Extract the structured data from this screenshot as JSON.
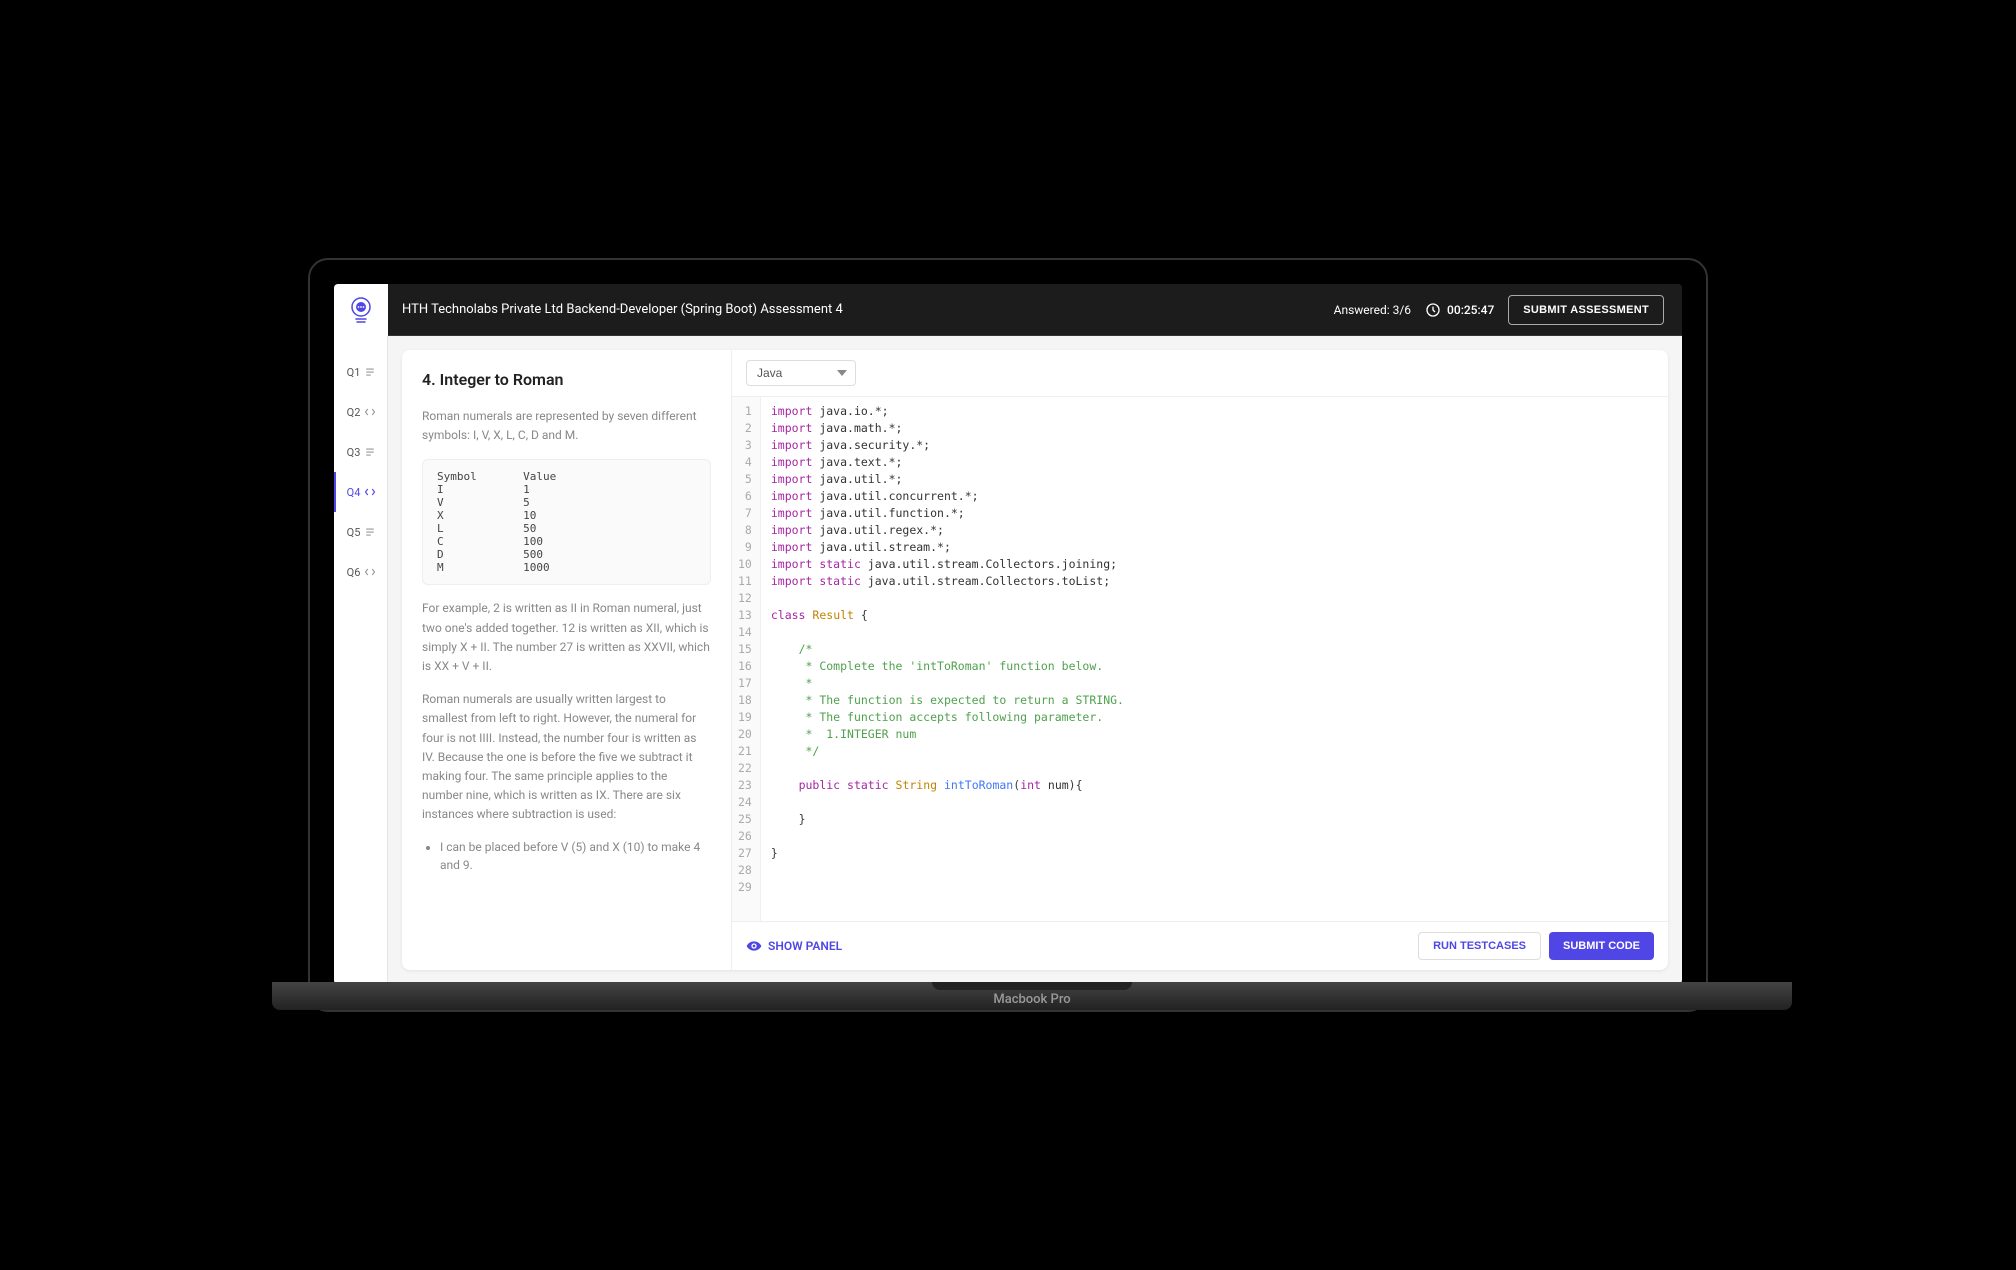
{
  "header": {
    "title": "HTH Technolabs Private Ltd Backend-Developer (Spring Boot) Assessment 4",
    "answered_label": "Answered: 3/6",
    "timer": "00:25:47",
    "submit_label": "SUBMIT ASSESSMENT"
  },
  "sidebar": {
    "items": [
      {
        "label": "Q1",
        "active": false,
        "type": "text"
      },
      {
        "label": "Q2",
        "active": false,
        "type": "code"
      },
      {
        "label": "Q3",
        "active": false,
        "type": "text"
      },
      {
        "label": "Q4",
        "active": true,
        "type": "code"
      },
      {
        "label": "Q5",
        "active": false,
        "type": "text"
      },
      {
        "label": "Q6",
        "active": false,
        "type": "code"
      }
    ]
  },
  "problem": {
    "title": "4. Integer to Roman",
    "intro": "Roman numerals are represented by seven different symbols: I, V, X, L, C, D and M.",
    "symbol_table": "Symbol       Value\nI            1\nV            5\nX            10\nL            50\nC            100\nD            500\nM            1000",
    "para2": "For example, 2 is written as II in Roman numeral, just two one's added together. 12 is written as XII, which is simply X + II. The number 27 is written as XXVII, which is XX + V + II.",
    "para3": "Roman numerals are usually written largest to smallest from left to right. However, the numeral for four is not IIII. Instead, the number four is written as IV. Because the one is before the five we subtract it making four. The same principle applies to the number nine, which is written as IX. There are six instances where subtraction is used:",
    "bullets": [
      "I can be placed before V (5) and X (10) to make 4 and 9."
    ]
  },
  "editor": {
    "language": "Java",
    "lines": [
      [
        [
          "kw",
          "import"
        ],
        [
          "",
          " java.io.*;"
        ]
      ],
      [
        [
          "kw",
          "import"
        ],
        [
          "",
          " java.math.*;"
        ]
      ],
      [
        [
          "kw",
          "import"
        ],
        [
          "",
          " java.security.*;"
        ]
      ],
      [
        [
          "kw",
          "import"
        ],
        [
          "",
          " java.text.*;"
        ]
      ],
      [
        [
          "kw",
          "import"
        ],
        [
          "",
          " java.util.*;"
        ]
      ],
      [
        [
          "kw",
          "import"
        ],
        [
          "",
          " java.util.concurrent.*;"
        ]
      ],
      [
        [
          "kw",
          "import"
        ],
        [
          "",
          " java.util.function.*;"
        ]
      ],
      [
        [
          "kw",
          "import"
        ],
        [
          "",
          " java.util.regex.*;"
        ]
      ],
      [
        [
          "kw",
          "import"
        ],
        [
          "",
          " java.util.stream.*;"
        ]
      ],
      [
        [
          "kw",
          "import static"
        ],
        [
          "",
          " java.util.stream.Collectors.joining;"
        ]
      ],
      [
        [
          "kw",
          "import static"
        ],
        [
          "",
          " java.util.stream.Collectors.toList;"
        ]
      ],
      [
        [
          "",
          ""
        ]
      ],
      [
        [
          "kw",
          "class"
        ],
        [
          "",
          " "
        ],
        [
          "typ",
          "Result"
        ],
        [
          "",
          " "
        ],
        [
          "punc",
          "{"
        ]
      ],
      [
        [
          "",
          ""
        ]
      ],
      [
        [
          "",
          "    "
        ],
        [
          "cmt",
          "/*"
        ]
      ],
      [
        [
          "",
          "     "
        ],
        [
          "cmt",
          "* Complete the 'intToRoman' function below."
        ]
      ],
      [
        [
          "",
          "     "
        ],
        [
          "cmt",
          "*"
        ]
      ],
      [
        [
          "",
          "     "
        ],
        [
          "cmt",
          "* The function is expected to return a STRING."
        ]
      ],
      [
        [
          "",
          "     "
        ],
        [
          "cmt",
          "* The function accepts following parameter."
        ]
      ],
      [
        [
          "",
          "     "
        ],
        [
          "cmt",
          "*  1.INTEGER num"
        ]
      ],
      [
        [
          "",
          "     "
        ],
        [
          "cmt",
          "*/"
        ]
      ],
      [
        [
          "",
          ""
        ]
      ],
      [
        [
          "",
          "    "
        ],
        [
          "kw",
          "public static"
        ],
        [
          "",
          " "
        ],
        [
          "typ",
          "String"
        ],
        [
          "",
          " "
        ],
        [
          "fn",
          "intToRoman"
        ],
        [
          "punc",
          "("
        ],
        [
          "kw",
          "int"
        ],
        [
          "",
          " num"
        ],
        [
          "punc",
          ")"
        ],
        [
          "punc",
          "{"
        ]
      ],
      [
        [
          "",
          ""
        ]
      ],
      [
        [
          "",
          "    "
        ],
        [
          "punc",
          "}"
        ]
      ],
      [
        [
          "",
          ""
        ]
      ],
      [
        [
          "punc",
          "}"
        ]
      ],
      [
        [
          "",
          ""
        ]
      ],
      [
        [
          "",
          ""
        ]
      ]
    ]
  },
  "footer": {
    "show_panel": "SHOW PANEL",
    "run": "RUN TESTCASES",
    "submit": "SUBMIT CODE"
  },
  "device_label": "Macbook Pro"
}
